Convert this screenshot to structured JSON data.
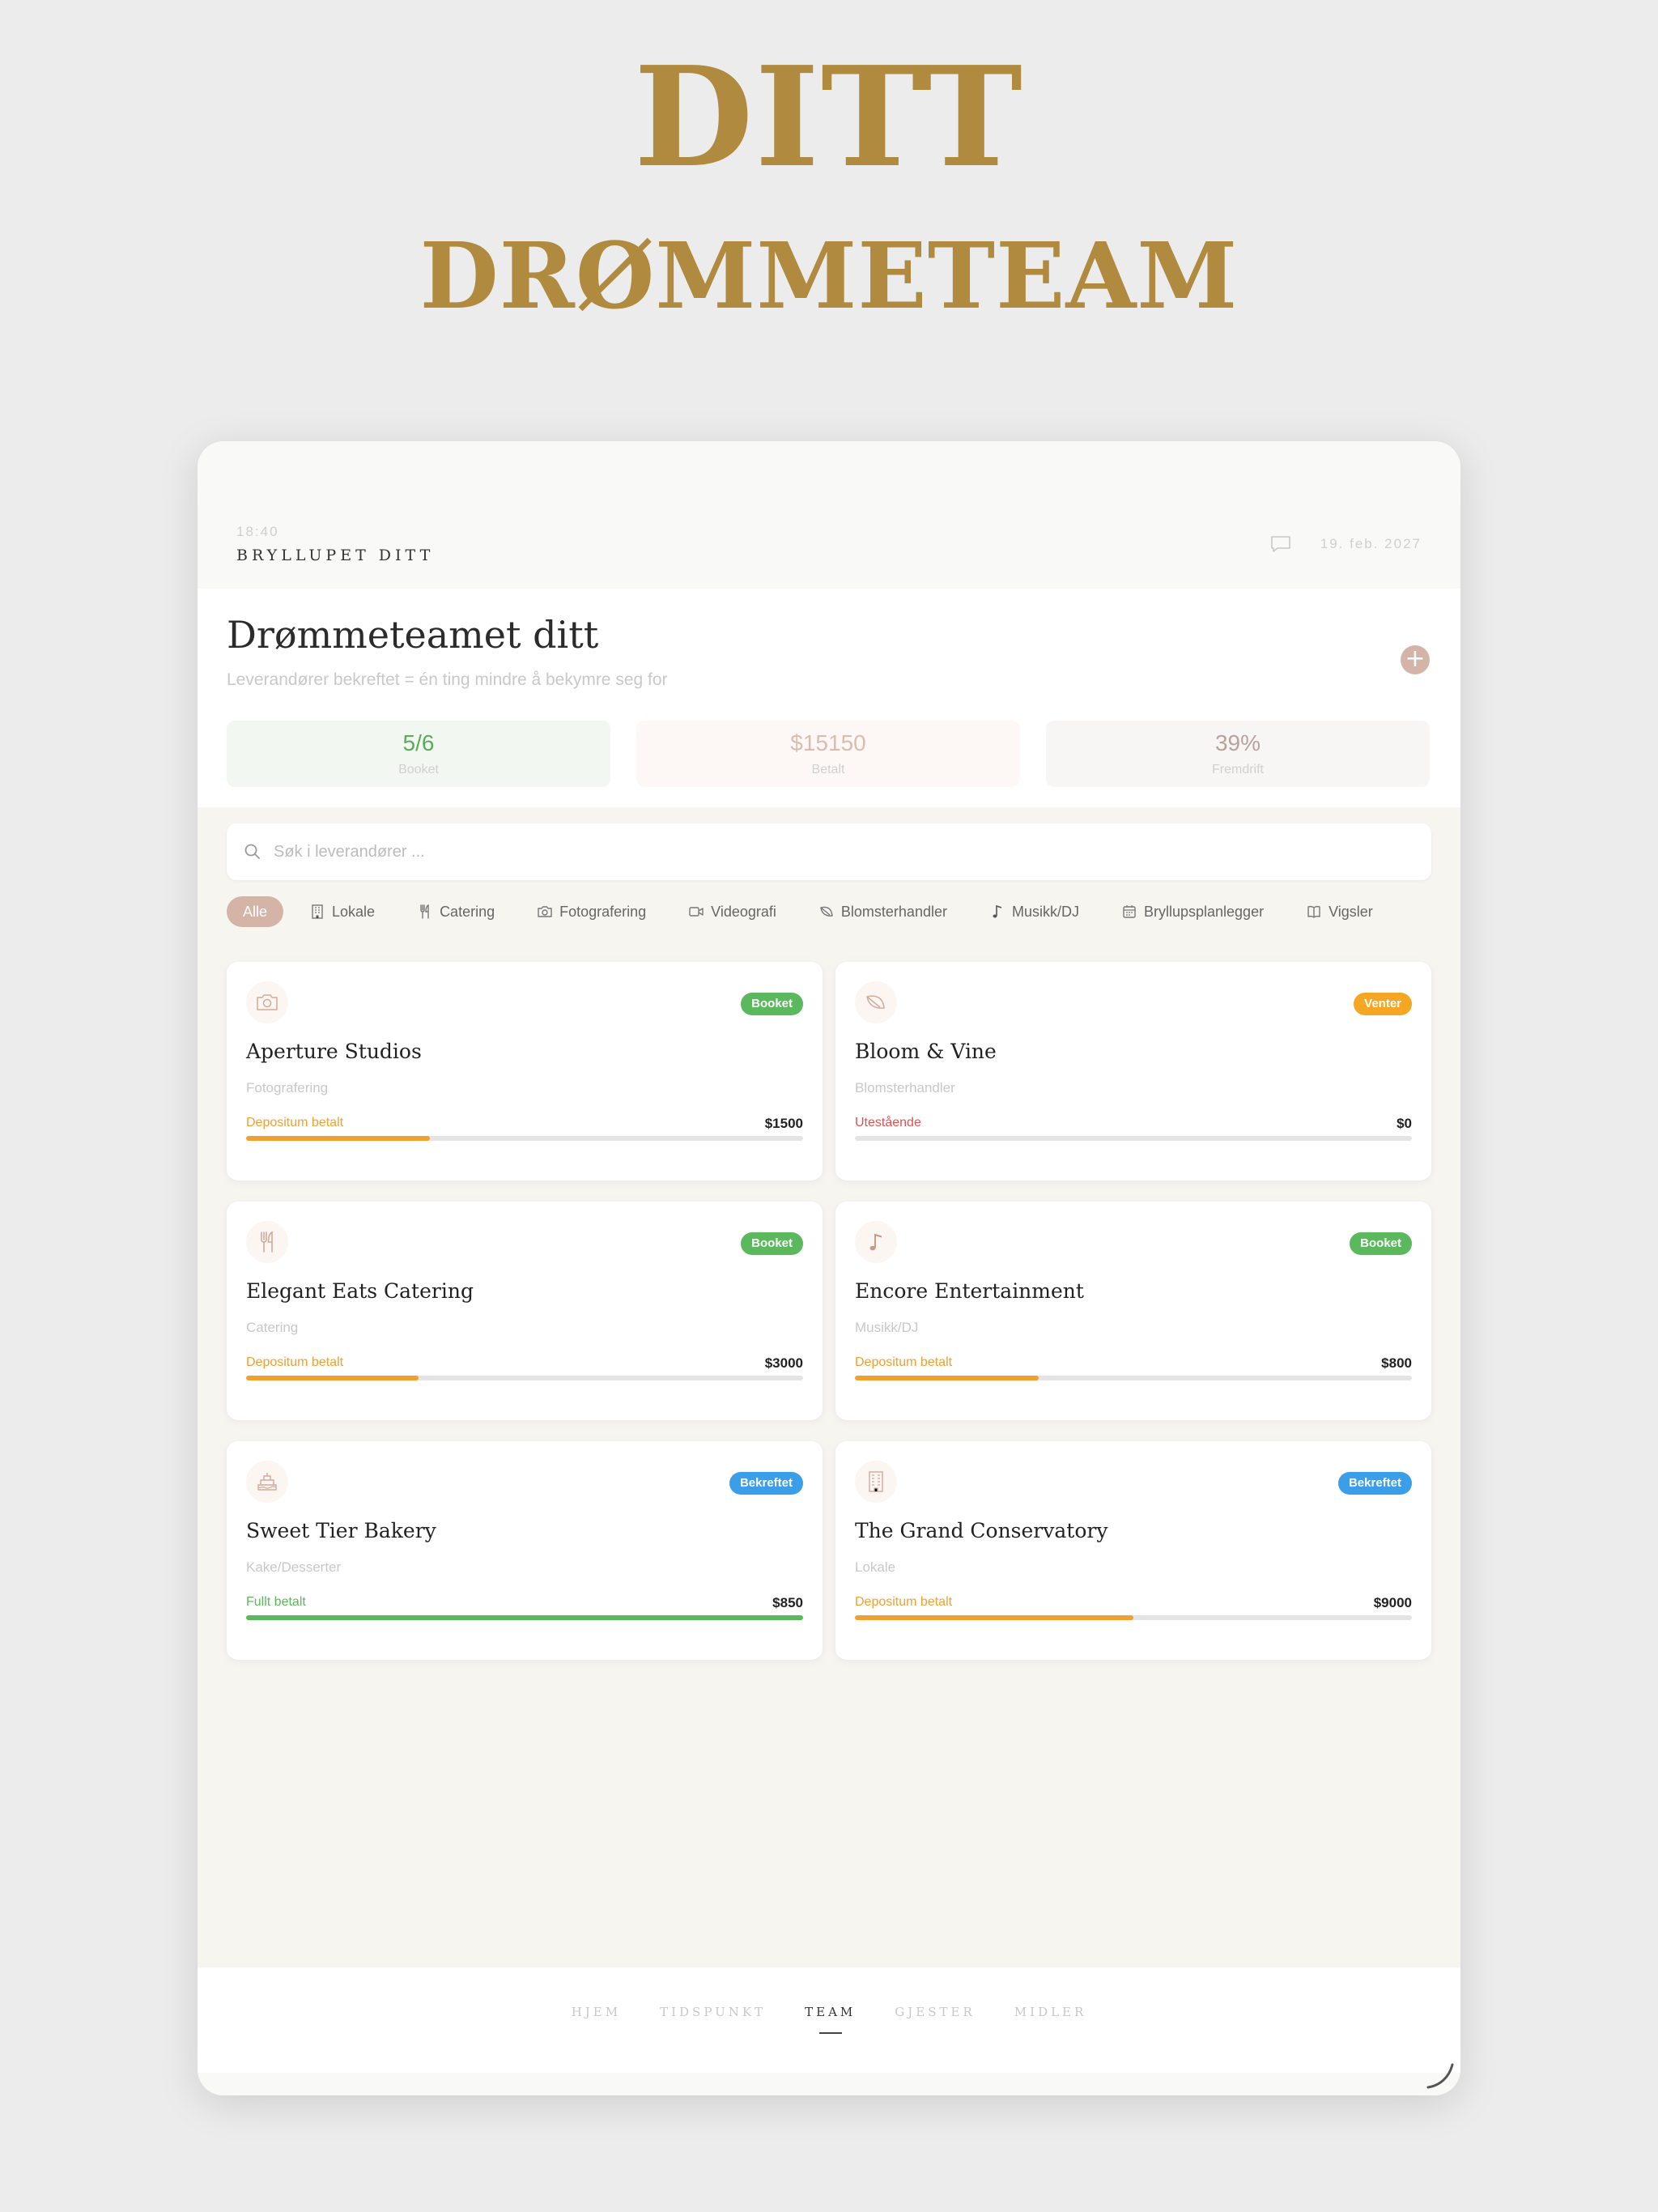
{
  "hero": {
    "line1": "DITT",
    "line2": "DRØMMETEAM"
  },
  "status_bar": {
    "time": "18:40",
    "title": "BRYLLUPET DITT",
    "date": "19. feb. 2027"
  },
  "header": {
    "title": "Drømmeteamet ditt",
    "subtitle": "Leverandører bekreftet = én ting mindre å bekymre seg for",
    "add_label": "+"
  },
  "stats": [
    {
      "value": "5/6",
      "label": "Booket"
    },
    {
      "value": "$15150",
      "label": "Betalt"
    },
    {
      "value": "39%",
      "label": "Fremdrift"
    }
  ],
  "search": {
    "placeholder": "Søk i leverandører ..."
  },
  "filters": [
    {
      "label": "Alle",
      "icon": "none"
    },
    {
      "label": "Lokale",
      "icon": "building-icon"
    },
    {
      "label": "Catering",
      "icon": "fork-knife-icon"
    },
    {
      "label": "Fotografering",
      "icon": "camera-icon"
    },
    {
      "label": "Videografi",
      "icon": "video-icon"
    },
    {
      "label": "Blomsterhandler",
      "icon": "leaf-icon"
    },
    {
      "label": "Musikk/DJ",
      "icon": "music-note-icon"
    },
    {
      "label": "Bryllupsplanlegger",
      "icon": "calendar-icon"
    },
    {
      "label": "Vigsler",
      "icon": "book-icon"
    }
  ],
  "vendors": [
    {
      "name": "Aperture Studios",
      "category": "Fotografering",
      "icon": "camera-icon",
      "badge": "Booket",
      "status": "Depositum betalt",
      "amount": "$1500",
      "progress": 0.33
    },
    {
      "name": "Bloom & Vine",
      "category": "Blomsterhandler",
      "icon": "leaf-icon",
      "badge": "Venter",
      "status": "Utestående",
      "amount": "$0",
      "progress": 0
    },
    {
      "name": "Elegant Eats Catering",
      "category": "Catering",
      "icon": "fork-knife-icon",
      "badge": "Booket",
      "status": "Depositum betalt",
      "amount": "$3000",
      "progress": 0.31
    },
    {
      "name": "Encore Entertainment",
      "category": "Musikk/DJ",
      "icon": "music-note-icon",
      "badge": "Booket",
      "status": "Depositum betalt",
      "amount": "$800",
      "progress": 0.33
    },
    {
      "name": "Sweet Tier Bakery",
      "category": "Kake/Desserter",
      "icon": "cake-icon",
      "badge": "Bekreftet",
      "status": "Fullt betalt",
      "amount": "$850",
      "progress": 1
    },
    {
      "name": "The Grand Conservatory",
      "category": "Lokale",
      "icon": "building-icon",
      "badge": "Bekreftet",
      "status": "Depositum betalt",
      "amount": "$9000",
      "progress": 0.5
    }
  ],
  "nav": [
    {
      "label": "HJEM"
    },
    {
      "label": "TIDSPUNKT"
    },
    {
      "label": "TEAM",
      "active": true
    },
    {
      "label": "GJESTER"
    },
    {
      "label": "MIDLER"
    }
  ],
  "colors": {
    "gold": "#b08a3e",
    "accent": "#d5b4a8",
    "booked": "#5cb85c",
    "waiting": "#f5a623",
    "confirmed": "#3a9ee8",
    "deposit": "#f0a030",
    "outstanding": "#e05050"
  }
}
